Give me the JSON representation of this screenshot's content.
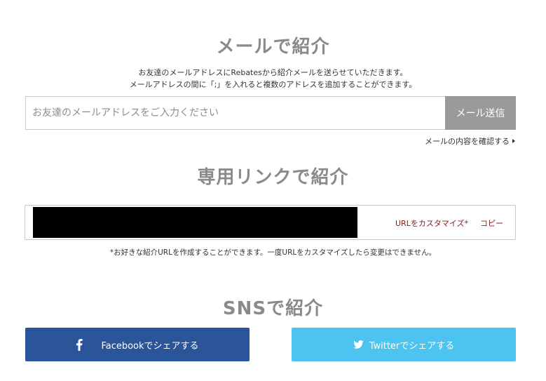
{
  "email_section": {
    "title": "メールで紹介",
    "description_line1": "お友達のメールアドレスにRebatesから紹介メールを送らせていただきます。",
    "description_line2": "メールアドレスの間に「;」を入れると複数のアドレスを追加することができます。",
    "input_placeholder": "お友達のメールアドレスをご入力ください",
    "input_value": "",
    "send_button": "メール送信",
    "confirm_link": "メールの内容を確認する"
  },
  "link_section": {
    "title": "専用リンクで紹介",
    "customize_link": "URLをカスタマイズ*",
    "copy_link": "コピー",
    "note": "*お好きな紹介URLを作成することができます。一度URLをカスタマイズしたら変更はできません。"
  },
  "sns_section": {
    "title": "SNSで紹介",
    "facebook_button": "Facebookでシェアする",
    "twitter_button": "Twitterでシェアする",
    "facebook_icon": "facebook-icon",
    "twitter_icon": "twitter-icon"
  },
  "colors": {
    "facebook": "#2a5599",
    "twitter": "#4dc3ef",
    "send_button": "#9a9a9a",
    "link_accent": "#8b1a1a",
    "title_gray": "#8a8a8a"
  }
}
